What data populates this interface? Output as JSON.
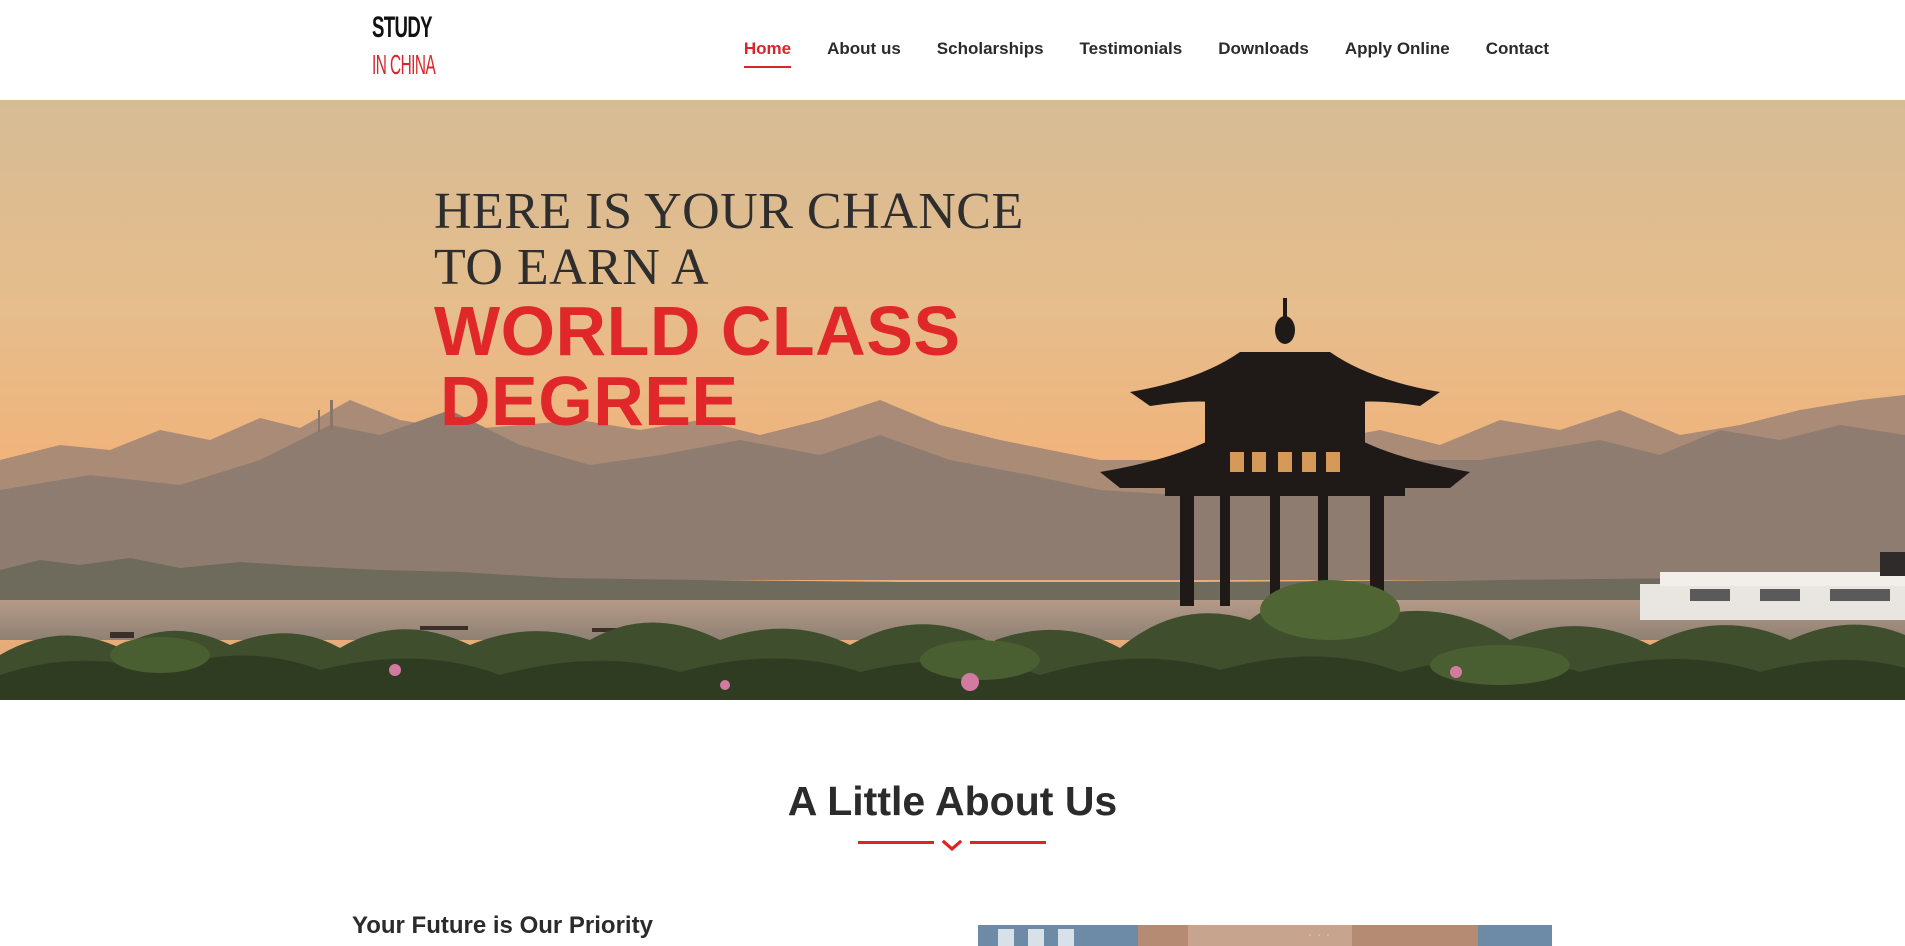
{
  "brand": {
    "logo_top": "STUDY",
    "logo_bottom": "IN CHINA",
    "accent_color": "#d9252a",
    "text_color": "#2b2b2b"
  },
  "nav": {
    "items": [
      {
        "label": "Home",
        "active": true
      },
      {
        "label": "About us"
      },
      {
        "label": "Scholarships"
      },
      {
        "label": "Testimonials"
      },
      {
        "label": "Downloads"
      },
      {
        "label": "Apply Online"
      },
      {
        "label": "Contact"
      }
    ]
  },
  "hero": {
    "line1": "HERE IS YOUR CHANCE",
    "line2": "TO EARN A",
    "highlight1": "WORLD CLASS",
    "highlight2": "DEGREE",
    "image_alt": "pagoda-sunset-lake"
  },
  "about": {
    "title": "A Little About Us",
    "divider_icon": "chevron-down-icon",
    "subheading": "Your Future is Our Priority",
    "image_alt": "university-building-photo"
  }
}
